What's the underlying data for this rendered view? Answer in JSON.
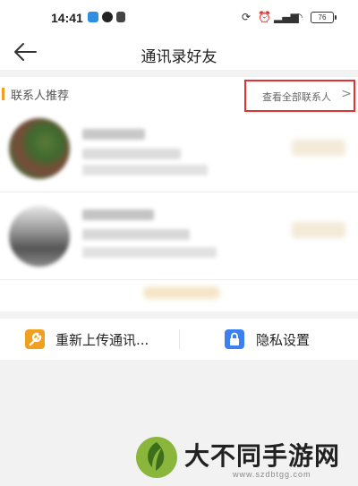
{
  "status_bar": {
    "time": "14:41",
    "battery": "76"
  },
  "header": {
    "title": "通讯录好友"
  },
  "recommend": {
    "title": "联系人推荐",
    "view_all_label": "查看全部联系人",
    "accent_color": "#f0a020",
    "highlight_color": "#e53030"
  },
  "actions": {
    "reupload_label": "重新上传通讯...",
    "privacy_label": "隐私设置",
    "reupload_icon_color": "#f0a020",
    "privacy_icon_color": "#3b7ff0"
  },
  "watermark": {
    "text": "大不同手游网",
    "url": "www.szdbtgg.com"
  }
}
